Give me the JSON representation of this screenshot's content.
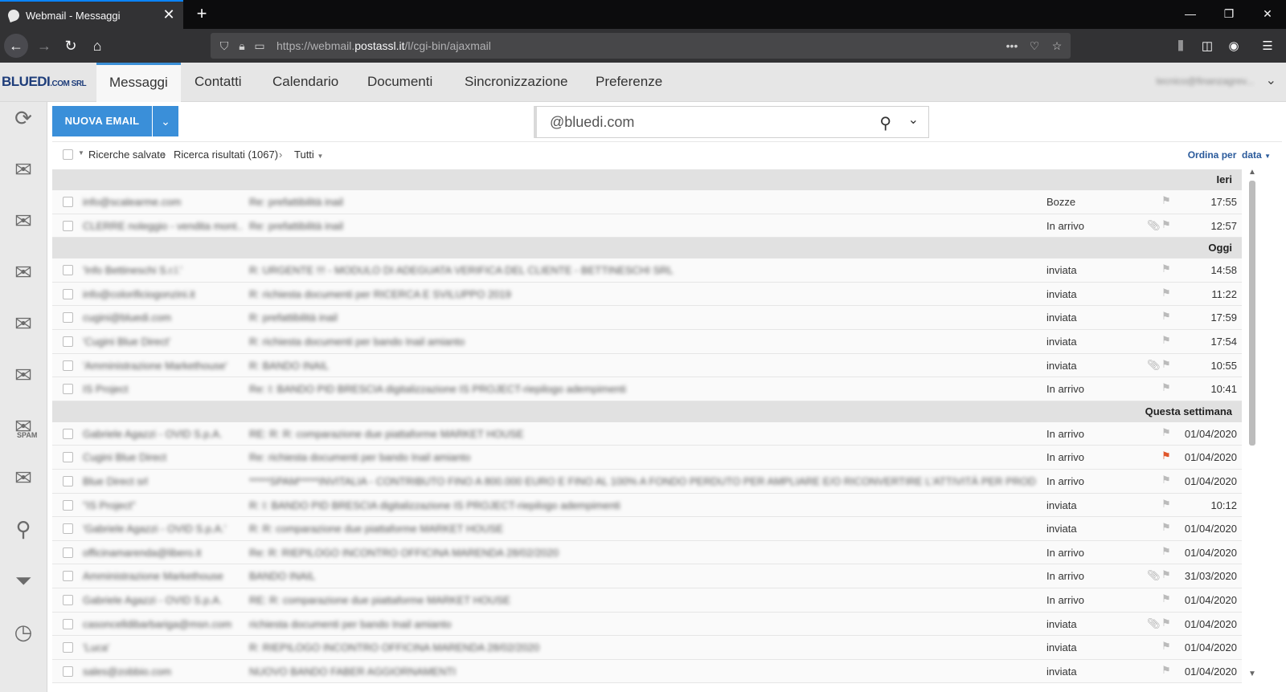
{
  "browser": {
    "tab_title": "Webmail - Messaggi",
    "url_prefix": "https://webmail.",
    "url_domain": "postassl.it",
    "url_path": "/l/cgi-bin/ajaxmail"
  },
  "app": {
    "logo_main": "BLUEDI",
    "logo_suffix": ".COM SRL",
    "tabs": [
      "Messaggi",
      "Contatti",
      "Calendario",
      "Documenti",
      "Sincronizzazione",
      "Preferenze"
    ],
    "account": "tecnico@finanzagrev..."
  },
  "toolbar": {
    "new_email": "NUOVA EMAIL",
    "search_value": "@bluedi.com"
  },
  "breadcrumb": {
    "saved": "Ricerche salvate",
    "results": "Ricerca risultati (1067)",
    "filter": "Tutti",
    "sort_label": "Ordina per",
    "sort_value": "data"
  },
  "sidebar_labels": {
    "spam": "SPAM"
  },
  "colors": {
    "accent": "#3a8fd9",
    "flag_red": "#e0562b"
  },
  "groups": [
    {
      "label": "Ieri",
      "rows": [
        {
          "sender": "info@scalearme.com",
          "subject": "Re: prefattibilità inail",
          "folder": "Bozze",
          "attach": false,
          "flag": false,
          "time": "17:55"
        },
        {
          "sender": "CLERRE noleggio - vendita mont...",
          "subject": "Re: prefattibilità inail",
          "folder": "In arrivo",
          "attach": true,
          "flag": false,
          "time": "12:57"
        }
      ]
    },
    {
      "label": "Oggi",
      "rows": [
        {
          "sender": "'Info Bettineschi S.r.l.'",
          "subject": "R: URGENTE !!! - MODULO DI ADEGUATA VERIFICA DEL CLIENTE - BETTINESCHI SRL",
          "folder": "inviata",
          "attach": false,
          "flag": false,
          "time": "14:58"
        },
        {
          "sender": "info@colorificiogonzini.it",
          "subject": "R: richiesta documenti per RICERCA E SVILUPPO 2019",
          "folder": "inviata",
          "attach": false,
          "flag": false,
          "time": "11:22"
        },
        {
          "sender": "cugini@bluedi.com",
          "subject": "R: prefattibilità inail",
          "folder": "inviata",
          "attach": false,
          "flag": false,
          "time": "17:59"
        },
        {
          "sender": "'Cugini Blue Direct'",
          "subject": "R: richiesta documenti per bando Inail amianto",
          "folder": "inviata",
          "attach": false,
          "flag": false,
          "time": "17:54"
        },
        {
          "sender": "'Amministrazione Markethouse'",
          "subject": "R: BANDO INAIL",
          "folder": "inviata",
          "attach": true,
          "flag": false,
          "time": "10:55"
        },
        {
          "sender": "IS Project",
          "subject": "Re: I: BANDO PID BRESCIA digitalizzazione IS PROJECT-riepilogo adempimenti",
          "folder": "In arrivo",
          "attach": false,
          "flag": false,
          "time": "10:41"
        }
      ]
    },
    {
      "label": "Questa settimana",
      "rows": [
        {
          "sender": "Gabriele Agazzi - OVID S.p.A.",
          "subject": "RE: R: R: comparazione due piattaforme MARKET HOUSE",
          "folder": "In arrivo",
          "attach": false,
          "flag": false,
          "time": "01/04/2020"
        },
        {
          "sender": "Cugini Blue Direct",
          "subject": "Re: richiesta documenti per bando Inail amianto",
          "folder": "In arrivo",
          "attach": false,
          "flag": true,
          "time": "01/04/2020"
        },
        {
          "sender": "Blue Direct srl",
          "subject": "*****SPAM*****INVITALIA - CONTRIBUTO FINO A 800.000 EURO E FINO AL 100% A FONDO PERDUTO PER AMPLIARE E/O RICONVERTIRE L'ATTIVITÀ PER PROD...",
          "folder": "In arrivo",
          "attach": false,
          "flag": false,
          "time": "01/04/2020"
        },
        {
          "sender": "\"IS Project\"",
          "subject": "R: I: BANDO PID BRESCIA digitalizzazione IS PROJECT-riepilogo adempimenti",
          "folder": "inviata",
          "attach": false,
          "flag": false,
          "time": "10:12"
        },
        {
          "sender": "'Gabriele Agazzi - OVID S.p.A.'",
          "subject": "R: R: comparazione due piattaforme MARKET HOUSE",
          "folder": "inviata",
          "attach": false,
          "flag": false,
          "time": "01/04/2020"
        },
        {
          "sender": "officinamarenda@libero.it",
          "subject": "Re: R: RIEPILOGO INCONTRO OFFICINA MARENDA 28/02/2020",
          "folder": "In arrivo",
          "attach": false,
          "flag": false,
          "time": "01/04/2020"
        },
        {
          "sender": "Amministrazione Markethouse",
          "subject": "BANDO INAIL",
          "folder": "In arrivo",
          "attach": true,
          "flag": false,
          "time": "31/03/2020"
        },
        {
          "sender": "Gabriele Agazzi - OVID S.p.A.",
          "subject": "RE: R: comparazione due piattaforme MARKET HOUSE",
          "folder": "In arrivo",
          "attach": false,
          "flag": false,
          "time": "01/04/2020"
        },
        {
          "sender": "casoncelldibarbariga@msn.com",
          "subject": "richiesta documenti per bando Inail amianto",
          "folder": "inviata",
          "attach": true,
          "flag": false,
          "time": "01/04/2020"
        },
        {
          "sender": "'Luca'",
          "subject": "R: RIEPILOGO INCONTRO OFFICINA MARENDA 28/02/2020",
          "folder": "inviata",
          "attach": false,
          "flag": false,
          "time": "01/04/2020"
        },
        {
          "sender": "sales@zobbio.com",
          "subject": "NUOVO BANDO FABER AGGIORNAMENTI",
          "folder": "inviata",
          "attach": false,
          "flag": false,
          "time": "01/04/2020"
        }
      ]
    }
  ]
}
